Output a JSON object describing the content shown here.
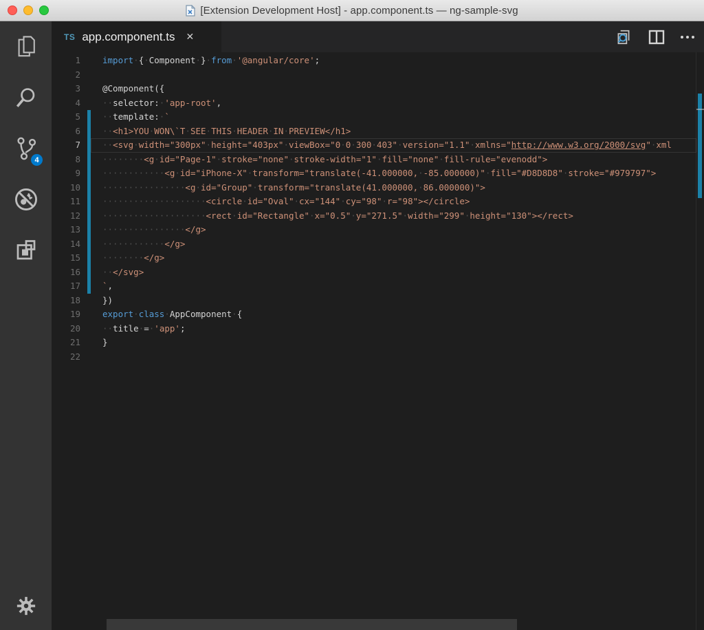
{
  "window": {
    "title": "[Extension Development Host] - app.component.ts — ng-sample-svg",
    "traffic_lights": [
      "close",
      "minimize",
      "zoom"
    ],
    "doc_icon": "file-icon"
  },
  "activity_bar": {
    "badge": "4",
    "items": [
      {
        "name": "explorer",
        "icon": "files-icon"
      },
      {
        "name": "search",
        "icon": "search-icon"
      },
      {
        "name": "source-control",
        "icon": "git-branch-icon",
        "badge": "4"
      },
      {
        "name": "debug",
        "icon": "bug-disabled-icon"
      },
      {
        "name": "extensions",
        "icon": "extensions-icon"
      }
    ],
    "settings_icon": "gear-icon"
  },
  "tab": {
    "file_type": "TS",
    "label": "app.component.ts",
    "close_glyph": "✕"
  },
  "editor_actions": [
    {
      "name": "open-preview",
      "icon": "preview-magnifier-icon"
    },
    {
      "name": "split-editor",
      "icon": "split-editor-icon"
    },
    {
      "name": "more-actions",
      "icon": "ellipsis-icon"
    }
  ],
  "colors": {
    "badge": "#007acc",
    "modified": "#1b81a8",
    "keyword": "#569cd6",
    "string": "#ce9178",
    "foreground": "#d4d4d4",
    "whitespace_dot": "#4e4e4e",
    "ts_label": "#519aba",
    "editor_bg": "#1e1e1e",
    "tabbar_bg": "#252526",
    "activitybar_bg": "#333333"
  },
  "editor": {
    "current_line": 7,
    "modified_lines": [
      5,
      6,
      7,
      8,
      9,
      10,
      11,
      12,
      13,
      14,
      15,
      16,
      17
    ],
    "lines": [
      {
        "n": 1,
        "t": [
          [
            "k",
            "import"
          ],
          [
            "w",
            1
          ],
          [
            "f",
            "{"
          ],
          [
            "w",
            1
          ],
          [
            "f",
            "Component"
          ],
          [
            "w",
            1
          ],
          [
            "f",
            "}"
          ],
          [
            "w",
            1
          ],
          [
            "k",
            "from"
          ],
          [
            "w",
            1
          ],
          [
            "s",
            "'@angular/core'"
          ],
          [
            "f",
            ";"
          ]
        ]
      },
      {
        "n": 2,
        "t": []
      },
      {
        "n": 3,
        "t": [
          [
            "f",
            "@Component({"
          ]
        ]
      },
      {
        "n": 4,
        "t": [
          [
            "w",
            2
          ],
          [
            "f",
            "selector:"
          ],
          [
            "w",
            1
          ],
          [
            "s",
            "'app-root'"
          ],
          [
            "f",
            ","
          ]
        ]
      },
      {
        "n": 5,
        "t": [
          [
            "w",
            2
          ],
          [
            "f",
            "template:"
          ],
          [
            "w",
            1
          ],
          [
            "s",
            "`"
          ]
        ]
      },
      {
        "n": 6,
        "t": [
          [
            "w",
            2
          ],
          [
            "s",
            "<h1>YOU"
          ],
          [
            "w",
            1
          ],
          [
            "s",
            "WON\\`T"
          ],
          [
            "w",
            1
          ],
          [
            "s",
            "SEE"
          ],
          [
            "w",
            1
          ],
          [
            "s",
            "THIS"
          ],
          [
            "w",
            1
          ],
          [
            "s",
            "HEADER"
          ],
          [
            "w",
            1
          ],
          [
            "s",
            "IN"
          ],
          [
            "w",
            1
          ],
          [
            "s",
            "PREVIEW</h1>"
          ]
        ]
      },
      {
        "n": 7,
        "t": [
          [
            "w",
            2
          ],
          [
            "s",
            "<svg"
          ],
          [
            "w",
            1
          ],
          [
            "s",
            "width=\"300px\""
          ],
          [
            "w",
            1
          ],
          [
            "s",
            "height=\"403px\""
          ],
          [
            "w",
            1
          ],
          [
            "s",
            "viewBox=\"0"
          ],
          [
            "w",
            1
          ],
          [
            "s",
            "0"
          ],
          [
            "w",
            1
          ],
          [
            "s",
            "300"
          ],
          [
            "w",
            1
          ],
          [
            "s",
            "403\""
          ],
          [
            "w",
            1
          ],
          [
            "s",
            "version=\"1.1\""
          ],
          [
            "w",
            1
          ],
          [
            "s",
            "xmlns=\""
          ],
          [
            "u",
            "http://www.w3.org/2000/svg"
          ],
          [
            "s",
            "\""
          ],
          [
            "w",
            1
          ],
          [
            "s",
            "xml"
          ]
        ]
      },
      {
        "n": 8,
        "t": [
          [
            "w",
            8
          ],
          [
            "s",
            "<g"
          ],
          [
            "w",
            1
          ],
          [
            "s",
            "id=\"Page-1\""
          ],
          [
            "w",
            1
          ],
          [
            "s",
            "stroke=\"none\""
          ],
          [
            "w",
            1
          ],
          [
            "s",
            "stroke-width=\"1\""
          ],
          [
            "w",
            1
          ],
          [
            "s",
            "fill=\"none\""
          ],
          [
            "w",
            1
          ],
          [
            "s",
            "fill-rule=\"evenodd\">"
          ]
        ]
      },
      {
        "n": 9,
        "t": [
          [
            "w",
            12
          ],
          [
            "s",
            "<g"
          ],
          [
            "w",
            1
          ],
          [
            "s",
            "id=\"iPhone-X\""
          ],
          [
            "w",
            1
          ],
          [
            "s",
            "transform=\"translate(-41.000000,"
          ],
          [
            "w",
            1
          ],
          [
            "s",
            "-85.000000)\""
          ],
          [
            "w",
            1
          ],
          [
            "s",
            "fill=\"#D8D8D8\""
          ],
          [
            "w",
            1
          ],
          [
            "s",
            "stroke=\"#979797\">"
          ]
        ]
      },
      {
        "n": 10,
        "t": [
          [
            "w",
            16
          ],
          [
            "s",
            "<g"
          ],
          [
            "w",
            1
          ],
          [
            "s",
            "id=\"Group\""
          ],
          [
            "w",
            1
          ],
          [
            "s",
            "transform=\"translate(41.000000,"
          ],
          [
            "w",
            1
          ],
          [
            "s",
            "86.000000)\">"
          ]
        ]
      },
      {
        "n": 11,
        "t": [
          [
            "w",
            20
          ],
          [
            "s",
            "<circle"
          ],
          [
            "w",
            1
          ],
          [
            "s",
            "id=\"Oval\""
          ],
          [
            "w",
            1
          ],
          [
            "s",
            "cx=\"144\""
          ],
          [
            "w",
            1
          ],
          [
            "s",
            "cy=\"98\""
          ],
          [
            "w",
            1
          ],
          [
            "s",
            "r=\"98\"></circle>"
          ]
        ]
      },
      {
        "n": 12,
        "t": [
          [
            "w",
            20
          ],
          [
            "s",
            "<rect"
          ],
          [
            "w",
            1
          ],
          [
            "s",
            "id=\"Rectangle\""
          ],
          [
            "w",
            1
          ],
          [
            "s",
            "x=\"0.5\""
          ],
          [
            "w",
            1
          ],
          [
            "s",
            "y=\"271.5\""
          ],
          [
            "w",
            1
          ],
          [
            "s",
            "width=\"299\""
          ],
          [
            "w",
            1
          ],
          [
            "s",
            "height=\"130\"></rect>"
          ]
        ]
      },
      {
        "n": 13,
        "t": [
          [
            "w",
            16
          ],
          [
            "s",
            "</g>"
          ]
        ]
      },
      {
        "n": 14,
        "t": [
          [
            "w",
            12
          ],
          [
            "s",
            "</g>"
          ]
        ]
      },
      {
        "n": 15,
        "t": [
          [
            "w",
            8
          ],
          [
            "s",
            "</g>"
          ]
        ]
      },
      {
        "n": 16,
        "t": [
          [
            "w",
            2
          ],
          [
            "s",
            "</svg>"
          ]
        ]
      },
      {
        "n": 17,
        "t": [
          [
            "s",
            "`"
          ],
          [
            "f",
            ","
          ]
        ]
      },
      {
        "n": 18,
        "t": [
          [
            "f",
            "})"
          ]
        ]
      },
      {
        "n": 19,
        "t": [
          [
            "k",
            "export"
          ],
          [
            "w",
            1
          ],
          [
            "k",
            "class"
          ],
          [
            "w",
            1
          ],
          [
            "f",
            "AppComponent"
          ],
          [
            "w",
            1
          ],
          [
            "f",
            "{"
          ]
        ]
      },
      {
        "n": 20,
        "t": [
          [
            "w",
            2
          ],
          [
            "f",
            "title"
          ],
          [
            "w",
            1
          ],
          [
            "f",
            "="
          ],
          [
            "w",
            1
          ],
          [
            "s",
            "'app'"
          ],
          [
            "f",
            ";"
          ]
        ]
      },
      {
        "n": 21,
        "t": [
          [
            "f",
            "}"
          ]
        ]
      },
      {
        "n": 22,
        "t": []
      }
    ]
  }
}
